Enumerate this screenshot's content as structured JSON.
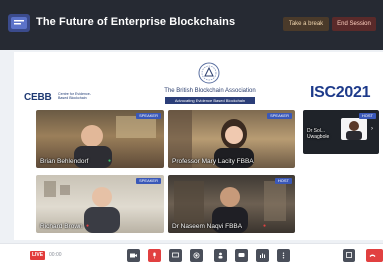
{
  "header": {
    "title": "The Future of Enterprise Blockchains",
    "take_break_label": "Take a break",
    "end_session_label": "End Session"
  },
  "branding": {
    "ceb_mark": "CEBB",
    "ceb_text": "Centre for Evidence-Based Blockchain",
    "bba_name": "The British Blockchain Association",
    "bba_tagline": "Advocating Evidence Based Blockchain",
    "isc_title": "ISC2021"
  },
  "participants": [
    {
      "name": "Brian Behlendorf",
      "badge": "SPEAKER"
    },
    {
      "name": "Professor Mary Lacity FBBA",
      "badge": "SPEAKER"
    },
    {
      "name": "Dr Sol... Uwagbole",
      "badge": "HOST"
    },
    {
      "name": "Richard Brown",
      "badge": "SPEAKER"
    },
    {
      "name": "Dr Naseem Naqvi FBBA",
      "badge": "HOST"
    }
  ],
  "footer": {
    "live_label": "LIVE",
    "timer": "00:00"
  },
  "colors": {
    "topbar": "#262a33",
    "accent": "#3a58b8",
    "danger": "#e14040"
  }
}
